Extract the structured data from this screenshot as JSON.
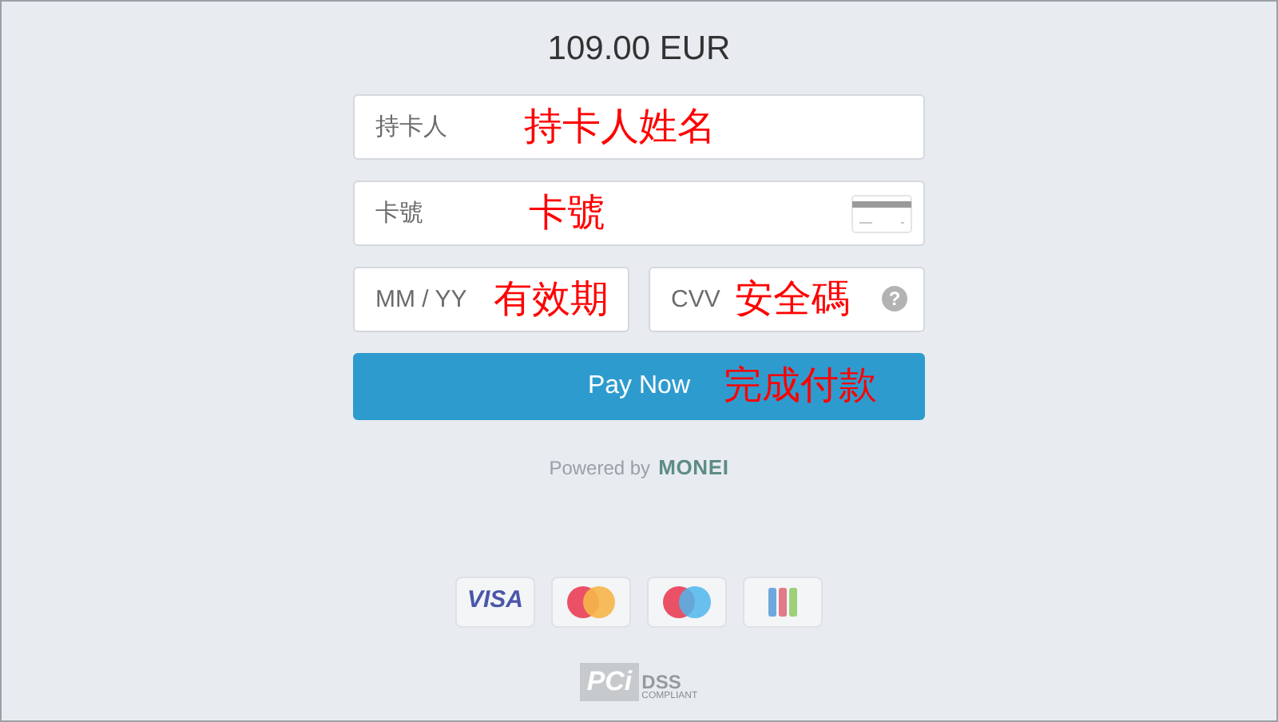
{
  "amount": "109.00 EUR",
  "rows": [
    [
      {
        "kind": "name",
        "placeholder": "持卡人",
        "annotation": "持卡人姓名"
      }
    ],
    [
      {
        "kind": "card",
        "placeholder": "卡號",
        "annotation": "卡號"
      }
    ],
    [
      {
        "kind": "expiry",
        "placeholder": "MM / YY",
        "annotation": "有效期"
      },
      {
        "kind": "cvv",
        "placeholder": "CVV",
        "annotation": "安全碼",
        "help": "?"
      }
    ]
  ],
  "pay_button": {
    "label": "Pay Now",
    "annotation": "完成付款"
  },
  "powered_by": {
    "text": "Powered by",
    "brand": "MONEI"
  },
  "card_brands": [
    {
      "kind": "visa",
      "text": "VISA"
    },
    {
      "kind": "mastercard"
    },
    {
      "kind": "maestro"
    },
    {
      "kind": "stripes"
    }
  ],
  "pci": {
    "mark": "PCi",
    "dss": "DSS",
    "compliant": "COMPLIANT"
  }
}
